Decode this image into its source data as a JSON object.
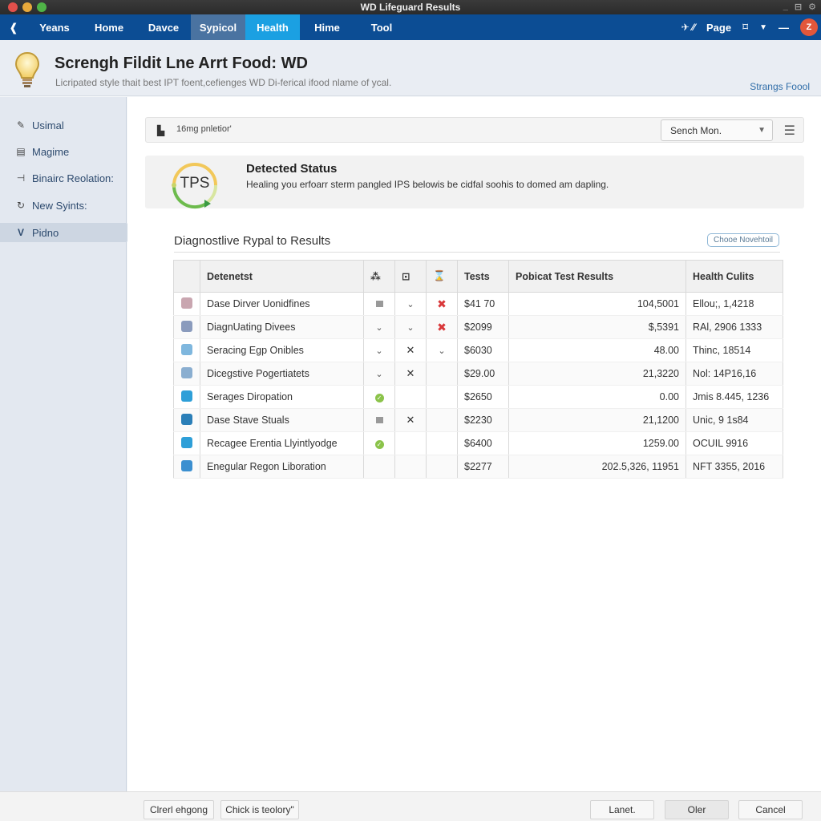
{
  "window": {
    "title": "WD Lifeguard Results"
  },
  "navbar": {
    "tabs": [
      {
        "label": "Yeans"
      },
      {
        "label": "Home"
      },
      {
        "label": "Davce"
      },
      {
        "label": "Sypicol"
      },
      {
        "label": "Health"
      },
      {
        "label": "Hime"
      },
      {
        "label": "Tool"
      }
    ],
    "active_tab": "Health",
    "page_label": "Page",
    "avatar_initial": "Z"
  },
  "header": {
    "title": "Screngh Fildit Lne Arrt Food: WD",
    "subtitle": "Licripated style thait best IPT foent,cefienges WD Di-ferical ifood nlame of ycal.",
    "link": "Strangs Foool"
  },
  "sidebar": {
    "items": [
      {
        "label": "Usimal",
        "icon": "pencil-icon"
      },
      {
        "label": "Magime",
        "icon": "document-icon"
      },
      {
        "label": "Binairc Reolation:",
        "icon": "branch-icon"
      },
      {
        "label": "New Syints:",
        "icon": "refresh-icon"
      },
      {
        "label": "Pidno",
        "icon": "chevron-icon",
        "active": true
      }
    ]
  },
  "toolbar": {
    "label": "16mg pnletior'",
    "select_value": "Sench Mon."
  },
  "status": {
    "badge": "TPS",
    "title": "Detected Status",
    "description": "Healing you erfoarr sterm pangled IPS belowis be cidfal soohis to domed am dapling."
  },
  "section": {
    "title": "Diagnostlive Rypal to Results",
    "button": "Chooe Novehtoil"
  },
  "table": {
    "headers": {
      "name": "Detenetst",
      "tests": "Tests",
      "results": "Pobicat Test Results",
      "health": "Health Culits"
    },
    "rows": [
      {
        "icon": "disk-icon",
        "icon_color": "#c9a6b0",
        "name": "Dase Dirver Uonidfines",
        "m1": "square",
        "m2": "check",
        "m3": "x-red",
        "tests": "$41 70",
        "results": "104,5001",
        "health": "Ellou;, 1,4218"
      },
      {
        "icon": "check-box-icon",
        "icon_color": "#8a9bbd",
        "name": "DiagnUating Divees",
        "m1": "check",
        "m2": "check",
        "m3": "x-red",
        "tests": "$2099",
        "results": "$,5391",
        "health": "RAl, 2906 1333"
      },
      {
        "icon": "image-icon",
        "icon_color": "#7fb7de",
        "name": "Seracing Egp Onibles",
        "m1": "check",
        "m2": "x",
        "m3": "check",
        "tests": "$6030",
        "results": "48.00",
        "health": "Thinc, 18514"
      },
      {
        "icon": "window-icon",
        "icon_color": "#8aaed0",
        "name": "Dicegstive Pogertiatets",
        "m1": "check",
        "m2": "x",
        "m3": "",
        "tests": "$29.00",
        "results": "21,3220",
        "health": "Nol: 14P16,16"
      },
      {
        "icon": "gauge-icon",
        "icon_color": "#2e9fd8",
        "name": "Serages Diropation",
        "m1": "ok",
        "m2": "",
        "m3": "",
        "tests": "$2650",
        "results": "0.00",
        "health": "Jmis 8.445, 1236"
      },
      {
        "icon": "funnel-icon",
        "icon_color": "#2b7fb8",
        "name": "Dase Stave Stuals",
        "m1": "square",
        "m2": "x",
        "m3": "",
        "tests": "$2230",
        "results": "21,1200",
        "health": "Unic, 9 1s84"
      },
      {
        "icon": "target-icon",
        "icon_color": "#2e9fd8",
        "name": "Recagee Erentia Llyintlyodge",
        "m1": "ok",
        "m2": "",
        "m3": "",
        "tests": "$6400",
        "results": "1259.00",
        "health": "OCUIL 9916"
      },
      {
        "icon": "pen-icon",
        "icon_color": "#3b8fd0",
        "name": "Enegular Regon Liboration",
        "m1": "",
        "m2": "",
        "m3": "",
        "tests": "$2277",
        "results": "202.5,326, 11951",
        "health": "NFT 3355, 2016"
      }
    ]
  },
  "footer": {
    "left_buttons": [
      "Clrerl ehgong",
      "Chick is teolory\""
    ],
    "right_buttons": [
      "Lanet.",
      "Oler",
      "Cancel"
    ]
  }
}
